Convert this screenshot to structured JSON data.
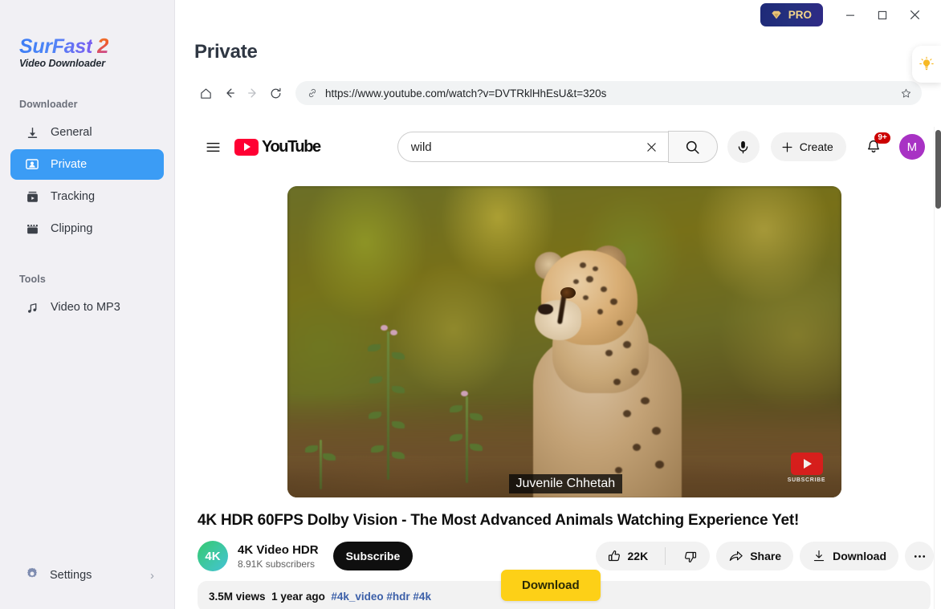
{
  "window": {
    "pro_label": "PRO",
    "minimize": "—",
    "maximize": "□",
    "close": "✕"
  },
  "brand": {
    "name_main": "SurFast",
    "name_number": "2",
    "subtitle": "Video Downloader"
  },
  "sidebar": {
    "sections": [
      {
        "label": "Downloader",
        "items": [
          {
            "label": "General",
            "icon": "download-arrow-icon",
            "active": false
          },
          {
            "label": "Private",
            "icon": "private-screen-icon",
            "active": true
          },
          {
            "label": "Tracking",
            "icon": "tracking-box-icon",
            "active": false
          },
          {
            "label": "Clipping",
            "icon": "clipping-film-icon",
            "active": false
          }
        ]
      },
      {
        "label": "Tools",
        "items": [
          {
            "label": "Video to MP3",
            "icon": "music-note-icon",
            "active": false
          }
        ]
      }
    ],
    "settings": {
      "label": "Settings",
      "icon": "gear-icon",
      "chevron": "›"
    }
  },
  "page": {
    "title": "Private",
    "tips_icon": "lightbulb-icon"
  },
  "browser": {
    "home_icon": "home-icon",
    "back_icon": "arrow-left-icon",
    "forward_icon": "arrow-right-icon",
    "reload_icon": "reload-icon",
    "link_icon": "link-icon",
    "url": "https://www.youtube.com/watch?v=DVTRklHhEsU&t=320s",
    "bookmark_icon": "star-icon"
  },
  "youtube": {
    "hamburger_icon": "hamburger-menu-icon",
    "logo_text": "YouTube",
    "search": {
      "value": "wild",
      "placeholder": "Search",
      "clear_icon": "close-x-icon",
      "search_icon": "magnifier-icon"
    },
    "mic_icon": "microphone-icon",
    "create": {
      "label": "Create",
      "icon": "plus-icon"
    },
    "notifications": {
      "icon": "bell-icon",
      "badge": "9+"
    },
    "avatar": {
      "initial": "M",
      "color": "#a832c4"
    },
    "player": {
      "caption": "Juvenile Chhetah",
      "watermark_label": "SUBSCRIBE",
      "watermark_icon": "youtube-play-icon"
    },
    "video": {
      "title": "4K HDR 60FPS Dolby Vision - The Most Advanced Animals Watching Experience Yet!",
      "channel_name": "4K Video HDR",
      "channel_avatar_text": "4K",
      "subscribers": "8.91K subscribers",
      "subscribe_label": "Subscribe",
      "likes": "22K",
      "like_icon": "thumbs-up-icon",
      "dislike_icon": "thumbs-down-icon",
      "share_label": "Share",
      "share_icon": "share-arrow-icon",
      "download_label": "Download",
      "download_icon": "download-icon",
      "more_label": "•••",
      "views": "3.5M views",
      "age": "1 year ago",
      "tags": "#4k_video #hdr #4k"
    }
  },
  "overlay": {
    "download_label": "Download",
    "color": "#fdd017"
  },
  "colors": {
    "accent": "#3b9cf5",
    "sidebar_bg": "#f1f0f4",
    "pro_badge": "#25307e",
    "youtube_red": "#ff0033"
  }
}
